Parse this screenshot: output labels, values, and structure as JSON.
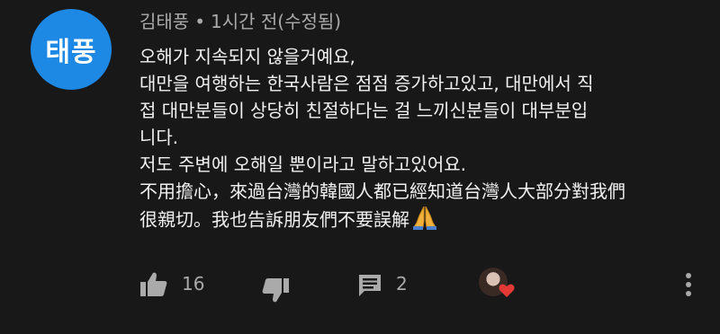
{
  "author": {
    "avatar_text": "태풍",
    "name": "김태풍",
    "separator": "•",
    "time": "1시간 전(수정됨)"
  },
  "comment": {
    "lines": [
      "오해가 지속되지 않을거예요,",
      "대만을 여행하는 한국사람은 점점 증가하고있고, 대만에서 직",
      "접 대만분들이 상당히 친절하다는 걸  느끼신분들이 대부분입",
      "니다.",
      "저도 주변에 오해일 뿐이라고 말하고있어요.",
      "不用擔心，來過台灣的韓國人都已經知道台灣人大部分對我們",
      "很親切。我也告訴朋友們不要誤解"
    ],
    "emoji": "folded-hands-emoji"
  },
  "actions": {
    "like_count": "16",
    "reply_count": "2"
  },
  "colors": {
    "background": "#181818",
    "text": "#f1f1f1",
    "muted": "#aaaaaa",
    "avatar": "#1e88e5",
    "heart": "#e53935"
  },
  "icons": [
    "thumbs-up-icon",
    "thumbs-down-icon",
    "reply-icon",
    "creator-heart-icon",
    "more-vert-icon"
  ]
}
